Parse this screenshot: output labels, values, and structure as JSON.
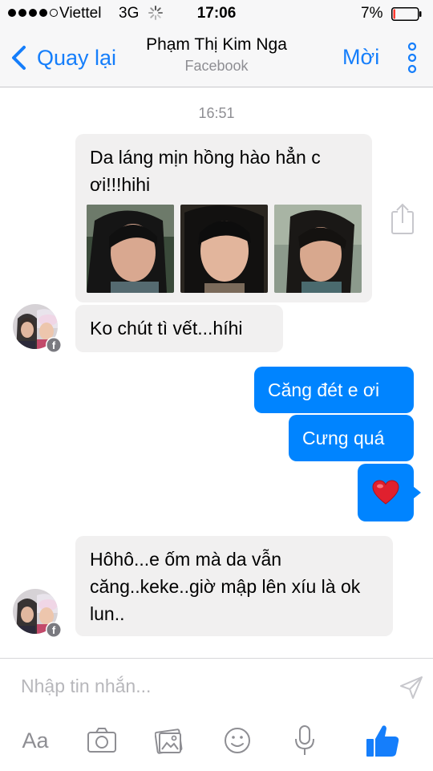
{
  "status_bar": {
    "carrier": "Viettel",
    "network": "3G",
    "time": "17:06",
    "battery_percent": "7%",
    "battery_level": 0.07,
    "signal_bars": 4,
    "signal_total": 5
  },
  "nav": {
    "back_label": "Quay lại",
    "title": "Phạm Thị Kim Nga",
    "subtitle": "Facebook",
    "invite_label": "Mời"
  },
  "conversation": {
    "timestamp": "16:51",
    "messages": [
      {
        "direction": "incoming",
        "text": "Da láng mịn hồng hào hẳn c ơi!!!hihi",
        "attachments": "3 photos"
      },
      {
        "direction": "incoming",
        "text": "Ko chút tì vết...híhi"
      },
      {
        "direction": "outgoing",
        "text": "Căng đét e ơi"
      },
      {
        "direction": "outgoing",
        "text": "Cưng quá"
      },
      {
        "direction": "outgoing",
        "emoji": "heart-icon"
      },
      {
        "direction": "incoming",
        "text": "Hôhô...e ốm mà da vẫn căng..keke..giờ mập lên xíu là ok lun.."
      }
    ]
  },
  "composer": {
    "placeholder": "Nhập tin nhắn...",
    "text_format_label": "Aa",
    "toolbar_icons": [
      "camera-icon",
      "gallery-icon",
      "sticker-icon",
      "microphone-icon",
      "like-icon"
    ]
  },
  "colors": {
    "accent": "#157efb",
    "outgoing_bubble": "#0084ff",
    "incoming_bubble": "#f1f0f0",
    "battery_low": "#ff3b30",
    "heart": "#e0202e"
  }
}
